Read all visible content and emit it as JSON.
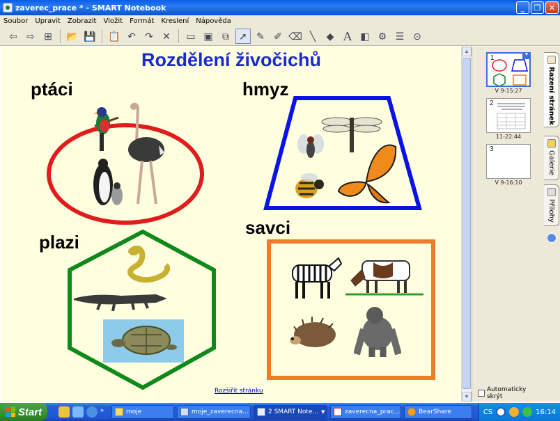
{
  "window": {
    "title": "zaverec_prace * - SMART Notebook"
  },
  "menu": [
    "Soubor",
    "Upravit",
    "Zobrazit",
    "Vložit",
    "Formát",
    "Kreslení",
    "Nápověda"
  ],
  "page": {
    "title": "Rozdělení živočichů",
    "expand_link": "Rozšířit stránku",
    "categories": {
      "birds": "ptáci",
      "insects": "hmyz",
      "reptiles": "plazi",
      "mammals": "savci"
    },
    "colors": {
      "title": "#1a2ad0",
      "birds": "#e01d1d",
      "insects": "#0a12e8",
      "reptiles": "#0e8a1a",
      "mammals": "#f07b2a"
    }
  },
  "sidebar": {
    "thumbnails": [
      {
        "num": "1",
        "time": "V 9-15:27"
      },
      {
        "num": "2",
        "time": "11-22:44"
      },
      {
        "num": "3",
        "time": "V 9-16:10"
      }
    ],
    "autohide_label": "Automaticky skrýt",
    "tabs": [
      "Razení stránek",
      "Galerie",
      "Přílohy"
    ]
  },
  "taskbar": {
    "start": "Start",
    "tasks": [
      "moje",
      "moje_zaverecna...",
      "2 SMART Note...",
      "zaverecna_prac...",
      "BearShare"
    ],
    "lang": "CS",
    "clock": "16:14"
  }
}
